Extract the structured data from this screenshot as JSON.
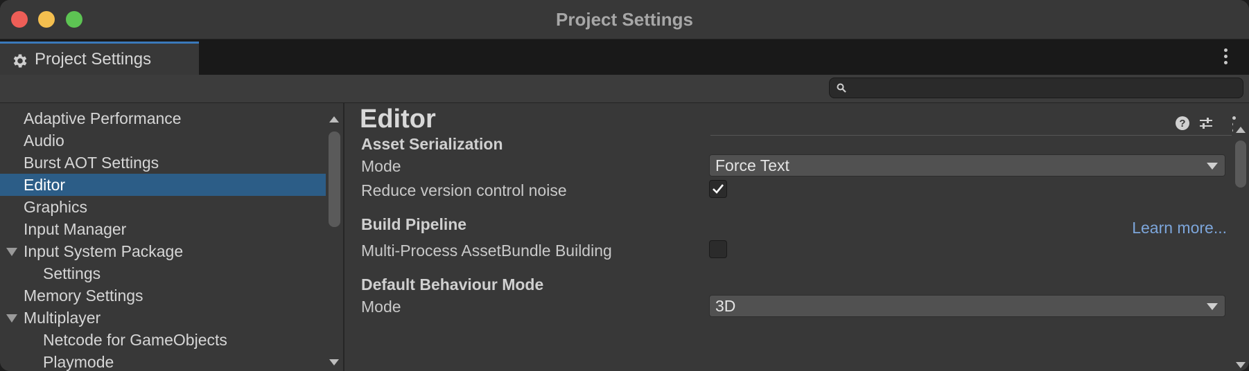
{
  "window": {
    "title": "Project Settings"
  },
  "tab": {
    "label": "Project Settings",
    "icon": "gear-icon"
  },
  "search": {
    "placeholder": "",
    "value": ""
  },
  "sidebar": {
    "items": [
      {
        "label": "Adaptive Performance",
        "level": 0,
        "expandable": false,
        "selected": false
      },
      {
        "label": "Audio",
        "level": 0,
        "expandable": false,
        "selected": false
      },
      {
        "label": "Burst AOT Settings",
        "level": 0,
        "expandable": false,
        "selected": false
      },
      {
        "label": "Editor",
        "level": 0,
        "expandable": false,
        "selected": true
      },
      {
        "label": "Graphics",
        "level": 0,
        "expandable": false,
        "selected": false
      },
      {
        "label": "Input Manager",
        "level": 0,
        "expandable": false,
        "selected": false
      },
      {
        "label": "Input System Package",
        "level": 0,
        "expandable": true,
        "selected": false
      },
      {
        "label": "Settings",
        "level": 1,
        "expandable": false,
        "selected": false
      },
      {
        "label": "Memory Settings",
        "level": 0,
        "expandable": false,
        "selected": false
      },
      {
        "label": "Multiplayer",
        "level": 0,
        "expandable": true,
        "selected": false
      },
      {
        "label": "Netcode for GameObjects",
        "level": 1,
        "expandable": false,
        "selected": false
      },
      {
        "label": "Playmode",
        "level": 1,
        "expandable": false,
        "selected": false
      }
    ]
  },
  "main": {
    "title": "Editor",
    "sections": {
      "asset_serialization": {
        "title": "Asset Serialization",
        "mode_label": "Mode",
        "mode_value": "Force Text",
        "reduce_noise_label": "Reduce version control noise",
        "reduce_noise_checked": true
      },
      "build_pipeline": {
        "title": "Build Pipeline",
        "learn_more": "Learn more...",
        "multiprocess_label": "Multi-Process AssetBundle Building",
        "multiprocess_checked": false
      },
      "default_behaviour": {
        "title": "Default Behaviour Mode",
        "mode_label": "Mode",
        "mode_value": "3D"
      }
    }
  },
  "colors": {
    "accent": "#2c5d87",
    "link": "#7da6db",
    "tab_highlight": "#3a79bb"
  }
}
